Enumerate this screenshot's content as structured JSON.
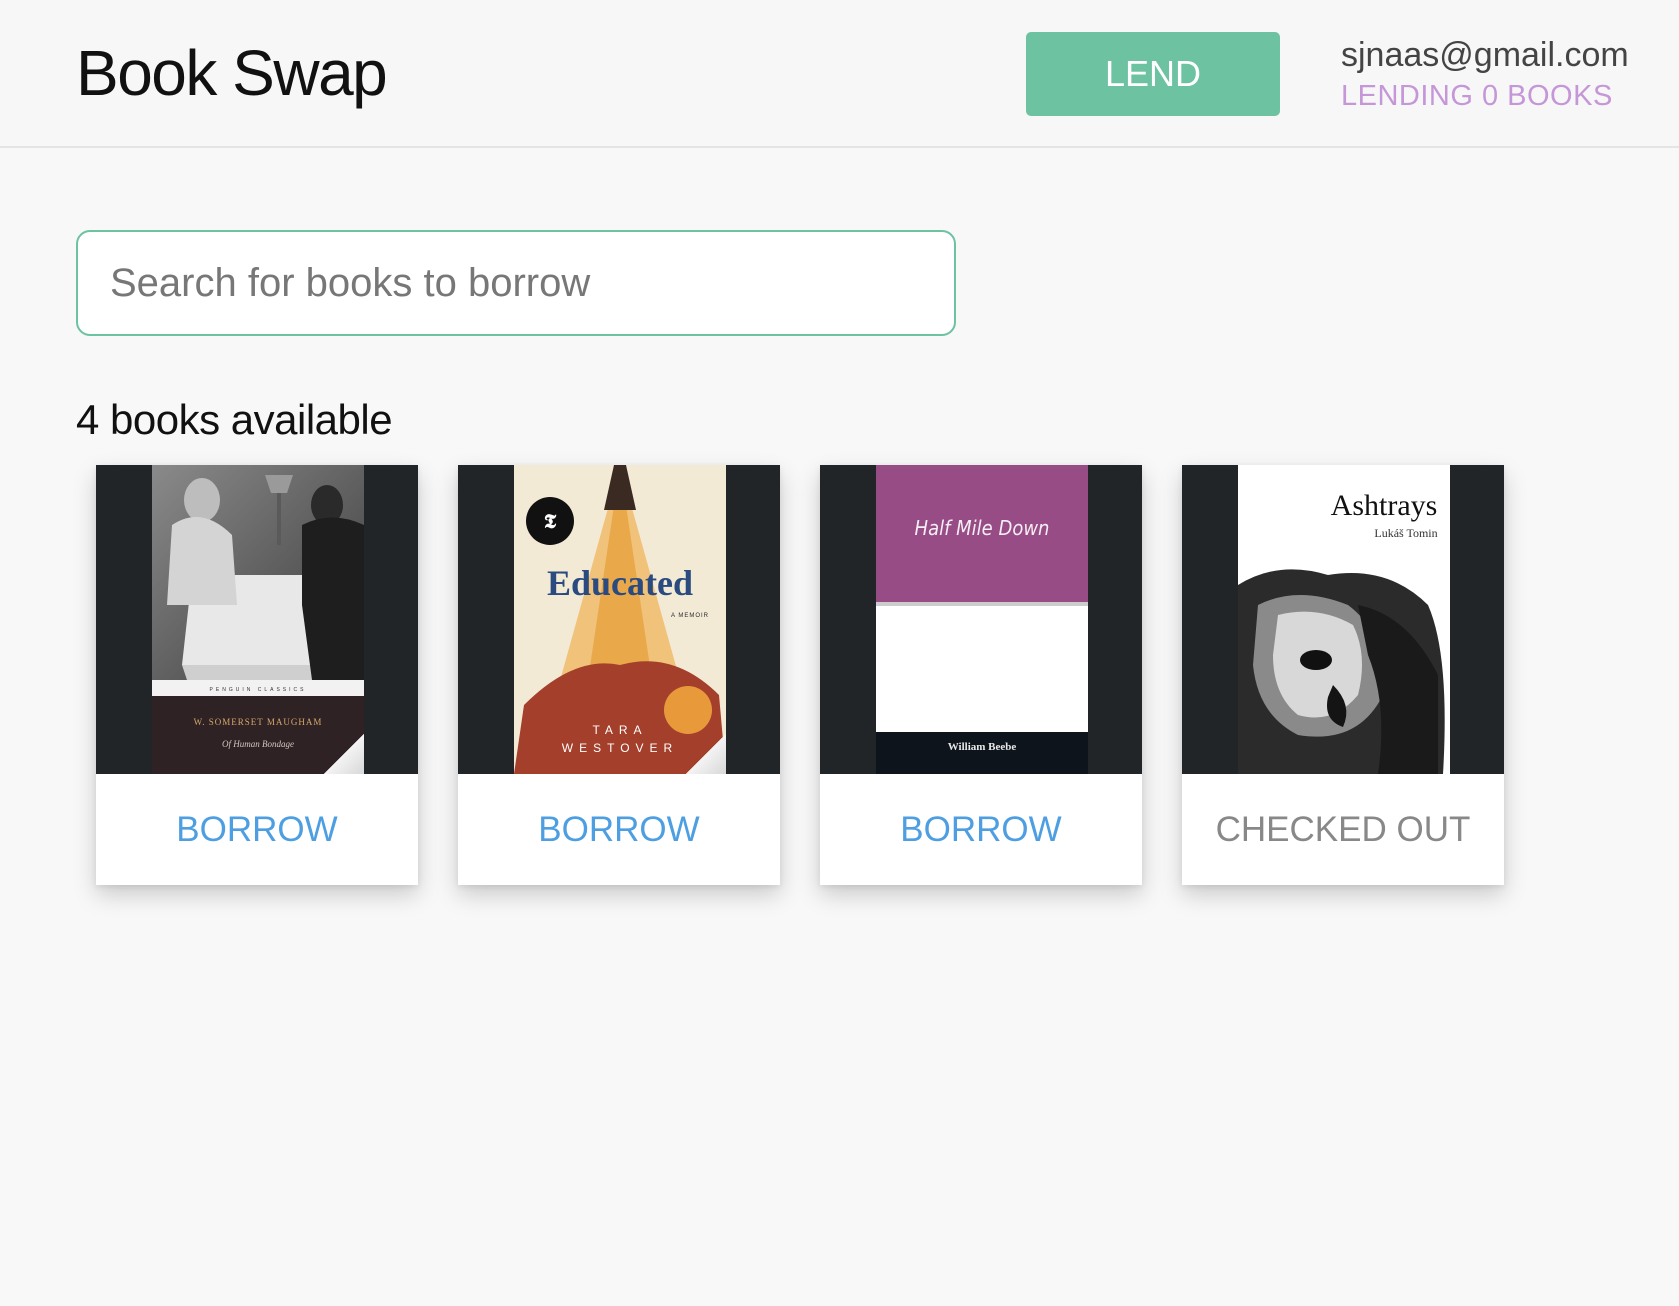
{
  "header": {
    "title": "Book Swap",
    "lend_label": "LEND",
    "user_email": "sjnaas@gmail.com",
    "lending_status": "LENDING 0 BOOKS"
  },
  "search": {
    "placeholder": "Search for books to borrow",
    "value": ""
  },
  "books_available": "4 books available",
  "books": [
    {
      "cover_text": {
        "series": "PENGUIN CLASSICS",
        "author": "W. SOMERSET MAUGHAM",
        "title": "Of Human Bondage"
      },
      "action": "BORROW"
    },
    {
      "cover_text": {
        "title": "Educated",
        "subtitle": "A MEMOIR",
        "author_line1": "TARA",
        "author_line2": "WESTOVER"
      },
      "action": "BORROW"
    },
    {
      "cover_text": {
        "title": "Half Mile Down",
        "author": "William Beebe"
      },
      "action": "BORROW"
    },
    {
      "cover_text": {
        "title": "Ashtrays",
        "author": "Lukáš Tomin"
      },
      "action": "CHECKED OUT"
    }
  ],
  "colors": {
    "accent_green": "#6cc2a1",
    "borrow_blue": "#4e9ee2",
    "lending_purple": "#c597d8",
    "cover_background": "#212528"
  }
}
